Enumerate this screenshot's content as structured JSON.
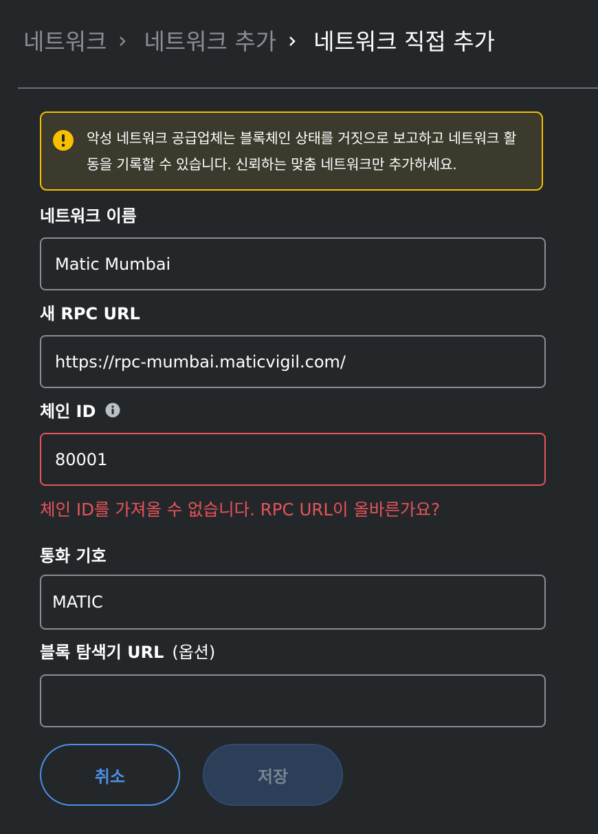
{
  "breadcrumb": {
    "items": [
      "네트워크",
      "네트워크 추가"
    ],
    "current": "네트워크 직접 추가"
  },
  "warning": {
    "icon": "warning-icon",
    "text": "악성 네트워크 공급업체는 블록체인 상태를 거짓으로 보고하고 네트워크 활동을 기록할 수 있습니다. 신뢰하는 맞춤 네트워크만 추가하세요.",
    "border_color": "#f8c000"
  },
  "form": {
    "network_name": {
      "label": "네트워크 이름",
      "value": "Matic Mumbai"
    },
    "rpc_url": {
      "label": "새 RPC URL",
      "value": "https://rpc-mumbai.maticvigil.com/"
    },
    "chain_id": {
      "label": "체인 ID",
      "icon": "info-icon",
      "value": "80001",
      "error": "체인 ID를 가져올 수 없습니다. RPC URL이 올바른가요?",
      "error_color": "#e8545a"
    },
    "currency_symbol": {
      "label": "통화 기호",
      "value": "MATIC"
    },
    "block_explorer": {
      "label": "블록 탐색기 URL",
      "optional": "(옵션)",
      "value": ""
    }
  },
  "buttons": {
    "cancel": "취소",
    "save": "저장",
    "accent_color": "#4a90e2"
  }
}
